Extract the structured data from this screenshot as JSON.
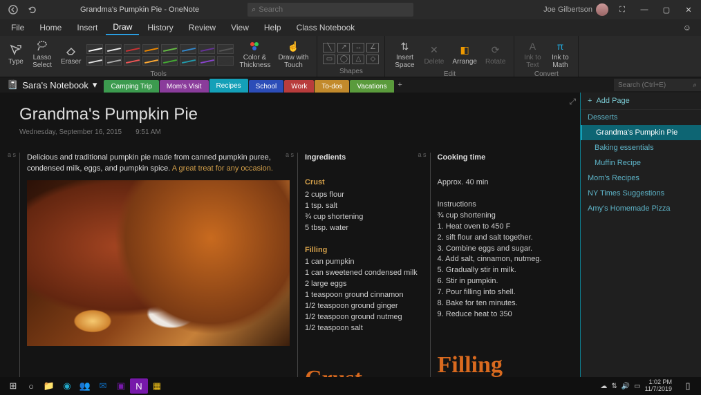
{
  "window": {
    "title": "Grandma's Pumpkin Pie  -  OneNote",
    "searchPlaceholder": "Search",
    "user": "Joe Gilbertson"
  },
  "menu": {
    "items": [
      "File",
      "Home",
      "Insert",
      "Draw",
      "History",
      "Review",
      "View",
      "Help",
      "Class Notebook"
    ],
    "active": "Draw"
  },
  "ribbon": {
    "tools": {
      "type": "Type",
      "lasso": "Lasso Select",
      "eraser": "Eraser",
      "colorThickness": "Color & Thickness",
      "drawTouch": "Draw with Touch",
      "label": "Tools",
      "pens": [
        "#ffffff",
        "#eee",
        "#c33",
        "#e80",
        "#6b4",
        "#38c",
        "#639",
        "#555",
        "#ddd",
        "#aaa",
        "#e55",
        "#fa3",
        "#4a3",
        "#29a",
        "#84c",
        "#333"
      ]
    },
    "shapes": {
      "label": "Shapes"
    },
    "edit": {
      "insertSpace": "Insert Space",
      "delete": "Delete",
      "arrange": "Arrange",
      "rotate": "Rotate",
      "label": "Edit"
    },
    "convert": {
      "inkText": "Ink to Text",
      "inkMath": "Ink to Math",
      "label": "Convert"
    }
  },
  "notebook": {
    "name": "Sara's Notebook",
    "sections": [
      {
        "label": "Camping Trip",
        "color": "#3c9b4f"
      },
      {
        "label": "Mom's Visit",
        "color": "#8a3c9b"
      },
      {
        "label": "Recipes",
        "color": "#14a0b8",
        "active": true
      },
      {
        "label": "School",
        "color": "#2c4db8"
      },
      {
        "label": "Work",
        "color": "#b83c3c"
      },
      {
        "label": "To-dos",
        "color": "#c28a2c"
      },
      {
        "label": "Vacations",
        "color": "#5a9b3c"
      }
    ],
    "searchPlaceholder": "Search (Ctrl+E)"
  },
  "page": {
    "title": "Grandma's Pumpkin Pie",
    "date": "Wednesday, September 16, 2015",
    "time": "9:51 AM",
    "desc1": "Delicious and traditional pumpkin pie made from canned pumpkin puree, condensed milk, eggs, and pumpkin spice. ",
    "desc2": "A great treat for any occasion.",
    "ingredientsTitle": "Ingredients",
    "crustTitle": "Crust",
    "crust": [
      "2 cups flour",
      "1 tsp. salt",
      "¾ cup shortening",
      "5 tbsp. water"
    ],
    "fillingTitle": "Filling",
    "filling": [
      "1 can pumpkin",
      "1 can sweetened condensed milk",
      "2 large eggs",
      "1 teaspoon ground cinnamon",
      "1/2 teaspoon ground ginger",
      "1/2 teaspoon ground nutmeg",
      "1/2 teaspoon salt"
    ],
    "cookingTitle": "Cooking time",
    "cookingTime": "Approx. 40 min",
    "instructionsTitle": "Instructions",
    "instructions": [
      "¾ cup shortening",
      "1. Heat oven to 450 F",
      "2. sift flour and salt together.",
      "3. Combine eggs and sugar.",
      "4. Add salt, cinnamon, nutmeg.",
      "5. Gradually stir in milk.",
      "6. Stir in pumpkin.",
      "7. Pour filling into shell.",
      "8. Bake for ten minutes.",
      "9. Reduce heat to 350"
    ],
    "ink1": "Crust",
    "ink2": "Filling"
  },
  "pagesPanel": {
    "addPage": "Add Page",
    "items": [
      {
        "label": "Desserts",
        "sub": false,
        "active": false
      },
      {
        "label": "Grandma's Pumpkin Pie",
        "sub": true,
        "active": true
      },
      {
        "label": "Baking essentials",
        "sub": true,
        "active": false
      },
      {
        "label": "Muffin Recipe",
        "sub": true,
        "active": false
      },
      {
        "label": "Mom's Recipes",
        "sub": false,
        "active": false
      },
      {
        "label": "NY Times Suggestions",
        "sub": false,
        "active": false
      },
      {
        "label": "Amy's Homemade Pizza",
        "sub": false,
        "active": false
      }
    ]
  },
  "taskbar": {
    "time": "1:02 PM",
    "date": "11/7/2019"
  }
}
